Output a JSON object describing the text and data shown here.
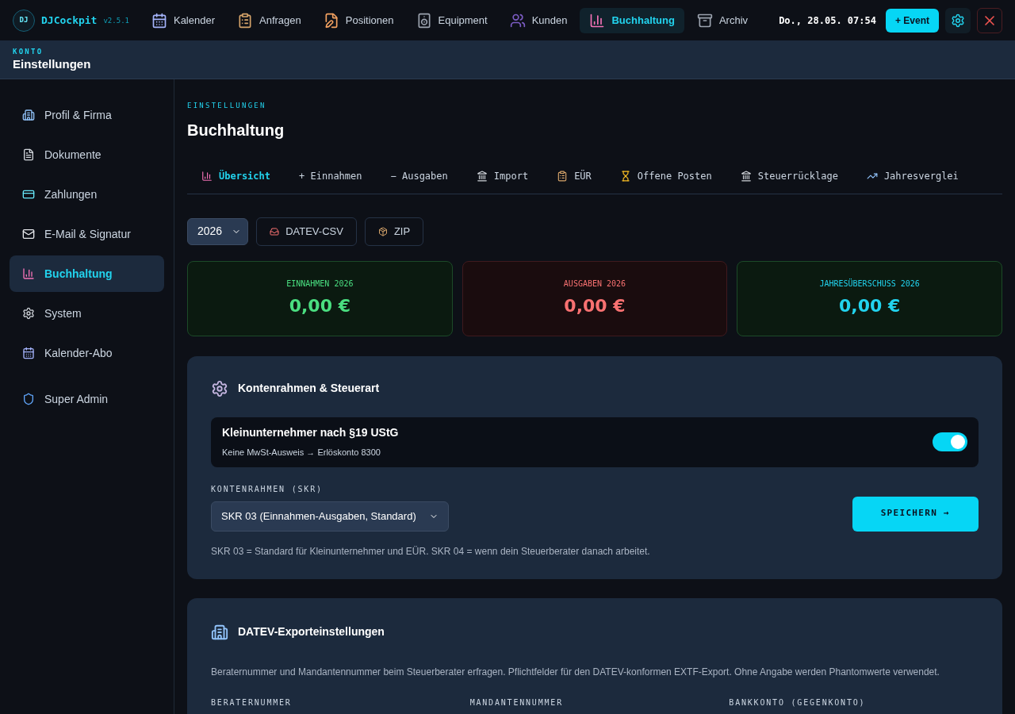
{
  "app": {
    "logo": "DJ",
    "name": "DJCockpit",
    "version": "v2.5.1"
  },
  "nav": [
    {
      "label": "Kalender",
      "selected": false
    },
    {
      "label": "Anfragen",
      "selected": false
    },
    {
      "label": "Positionen",
      "selected": false
    },
    {
      "label": "Equipment",
      "selected": false
    },
    {
      "label": "Kunden",
      "selected": false
    },
    {
      "label": "Buchhaltung",
      "selected": true
    },
    {
      "label": "Archiv",
      "selected": false
    }
  ],
  "clock": "Do., 28.05. 07:54",
  "event_button": "+ Event",
  "subheader": {
    "eyebrow": "KONTO",
    "title": "Einstellungen"
  },
  "sidebar": [
    {
      "label": "Profil & Firma",
      "selected": false
    },
    {
      "label": "Dokumente",
      "selected": false
    },
    {
      "label": "Zahlungen",
      "selected": false
    },
    {
      "label": "E-Mail & Signatur",
      "selected": false
    },
    {
      "label": "Buchhaltung",
      "selected": true
    },
    {
      "label": "System",
      "selected": false
    },
    {
      "label": "Kalender-Abo",
      "selected": false
    },
    {
      "label": "Super Admin",
      "selected": false
    }
  ],
  "page": {
    "eyebrow": "EINSTELLUNGEN",
    "title": "Buchhaltung"
  },
  "tabs": [
    {
      "label": "Übersicht",
      "selected": true
    },
    {
      "label": "+ Einnahmen",
      "selected": false
    },
    {
      "label": "− Ausgaben",
      "selected": false
    },
    {
      "label": "Import",
      "selected": false
    },
    {
      "label": "EÜR",
      "selected": false
    },
    {
      "label": "Offene Posten",
      "selected": false
    },
    {
      "label": "Steuerrücklage",
      "selected": false
    },
    {
      "label": "Jahresverglei",
      "selected": false
    }
  ],
  "toolbar": {
    "year": "2026",
    "buttons": [
      "DATEV-CSV",
      "ZIP"
    ]
  },
  "summary": [
    {
      "label": "EINNAHMEN 2026",
      "value": "0,00 €",
      "color": "#4ade80"
    },
    {
      "label": "AUSGABEN 2026",
      "value": "0,00 €",
      "color": "#f87171"
    },
    {
      "label": "JAHRESÜBERSCHUSS 2026",
      "value": "0,00 €",
      "color": "#22d3ee"
    }
  ],
  "kontenrahmen": {
    "title": "Kontenrahmen & Steuerart",
    "toggle": {
      "title": "Kleinunternehmer nach §19 UStG",
      "subtitle": "Keine MwSt-Ausweis → Erlöskonto 8300",
      "on": true
    },
    "select_label": "KONTENRAHMEN (SKR)",
    "select_value": "SKR 03 (Einnahmen-Ausgaben, Standard)",
    "save_button": "SPEICHERN →",
    "hint": "SKR 03 = Standard für Kleinunternehmer und EÜR. SKR 04 = wenn dein Steuerberater danach arbeitet."
  },
  "datev": {
    "title": "DATEV-Exporteinstellungen",
    "description": "Beraternummer und Mandantennummer beim Steuerberater erfragen. Pflichtfelder für den DATEV-konformen EXTF-Export. Ohne Angabe werden Phantomwerte verwendet.",
    "field_labels": [
      "BERATERNUMMER",
      "MANDANTENNUMMER",
      "BANKKONTO (GEGENKONTO)"
    ]
  }
}
